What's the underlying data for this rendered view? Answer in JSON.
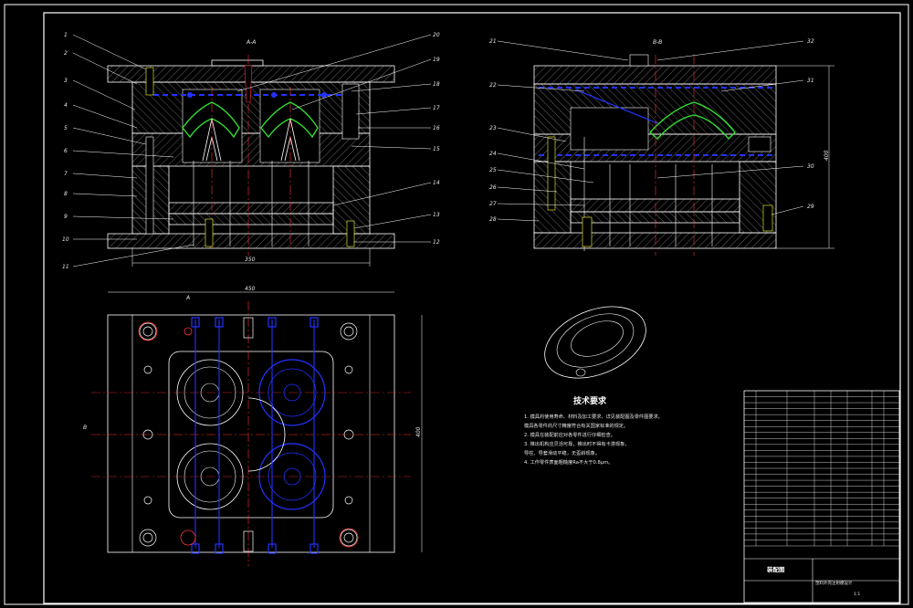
{
  "section_labels": {
    "left": "A-A",
    "right": "B-B"
  },
  "dimensions": {
    "width_front": "350",
    "width_plan": "450",
    "height_right": "400",
    "height_plan": "400"
  },
  "plan_markers": {
    "a": "A",
    "b": "B"
  },
  "callouts_left": [
    "1",
    "2",
    "3",
    "4",
    "5",
    "6",
    "7",
    "8",
    "9",
    "10",
    "11"
  ],
  "callouts_mid": [
    "20",
    "19",
    "18",
    "17",
    "16",
    "15",
    "14",
    "13",
    "12"
  ],
  "callouts_right_l": [
    "21",
    "22",
    "23",
    "24",
    "25",
    "26",
    "27",
    "28"
  ],
  "callouts_right_r": [
    "32",
    "31",
    "30",
    "29"
  ],
  "tech_notes": {
    "title": "技术要求",
    "lines": [
      "1. 模具的使用寿命、材料及加工要求，详见装配图及零件图要求。",
      "   模具各零件的尺寸精度符合有关国家标准的规定。",
      "2. 模具在装配前应对各零件进行仔细检查。",
      "3. 推出机构应灵活可靠，推出时不得有卡滞现象，",
      "   导柱、导套滑动平稳，无歪斜现象。",
      "4. 工作零件表面粗糙度Ra不大于0.8μm。"
    ]
  },
  "title_block": {
    "drawing_title": "装配图",
    "project_name": "塑料外壳注射模设计",
    "scale": "1:1",
    "rows": 26
  },
  "colors": {
    "line": "#ffffff",
    "blue": "#2233ff",
    "green": "#33dd33",
    "red": "#ff3333",
    "yellow": "#ffff33",
    "hatch": "#bbbbbb",
    "cyan": "#33ffff"
  }
}
